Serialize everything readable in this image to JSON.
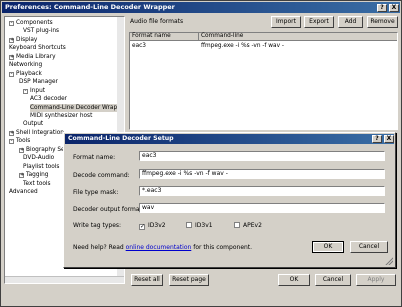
{
  "window": {
    "title": "Preferences: Command-Line Decoder Wrapper",
    "help_label": "?",
    "close_label": "X"
  },
  "tree": {
    "items": [
      {
        "label": "Components",
        "expander": "-"
      },
      {
        "label": "VST plug-ins",
        "expander": ""
      },
      {
        "label": "Display",
        "expander": "+"
      },
      {
        "label": "Keyboard Shortcuts",
        "expander": ""
      },
      {
        "label": "Media Library",
        "expander": "+"
      },
      {
        "label": "Networking",
        "expander": ""
      },
      {
        "label": "Playback",
        "expander": "-"
      },
      {
        "label": "DSP Manager",
        "expander": ""
      },
      {
        "label": "Input",
        "expander": "-"
      },
      {
        "label": "AC3 decoder",
        "expander": ""
      },
      {
        "label": "Command-Line Decoder Wrappe",
        "expander": ""
      },
      {
        "label": "MIDI synthesizer host",
        "expander": ""
      },
      {
        "label": "Output",
        "expander": ""
      },
      {
        "label": "Shell Integration",
        "expander": "+"
      },
      {
        "label": "Tools",
        "expander": "-"
      },
      {
        "label": "Biography Se",
        "expander": "+"
      },
      {
        "label": "DVD-Audio",
        "expander": ""
      },
      {
        "label": "Playlist tools",
        "expander": ""
      },
      {
        "label": "Tagging",
        "expander": "+"
      },
      {
        "label": "Text tools",
        "expander": ""
      },
      {
        "label": "Advanced",
        "expander": ""
      }
    ]
  },
  "panel": {
    "label": "Audio file formats",
    "buttons": {
      "import": "Import",
      "export": "Export",
      "add": "Add",
      "remove": "Remove"
    },
    "columns": {
      "format_name": "Format name",
      "command_line": "Command-line"
    },
    "rows": [
      {
        "format_name": "eac3",
        "command_line": "ffmpeg.exe -i %s -vn -f wav -"
      }
    ]
  },
  "bottom": {
    "reset_all": "Reset all",
    "reset_page": "Reset page",
    "ok": "OK",
    "cancel": "Cancel",
    "apply": "Apply"
  },
  "dialog": {
    "title": "Command-Line Decoder Setup",
    "help_label": "?",
    "close_label": "X",
    "format_name_label": "Format name:",
    "format_name_value": "eac3",
    "decode_command_label": "Decode command:",
    "decode_command_value": "ffmpeg.exe -i %s -vn -f wav -",
    "file_type_mask_label": "File type mask:",
    "file_type_mask_value": "*.eac3",
    "output_format_label": "Decoder output format:",
    "output_format_value": "wav",
    "write_tag_label": "Write tag types:",
    "tags": [
      {
        "label": "ID3v2",
        "checked": true
      },
      {
        "label": "ID3v1",
        "checked": false
      },
      {
        "label": "APEv2",
        "checked": false
      }
    ],
    "help_prefix": "Need help? Read ",
    "help_link": "online documentation",
    "help_suffix": " for this component.",
    "ok": "OK",
    "cancel": "Cancel"
  }
}
